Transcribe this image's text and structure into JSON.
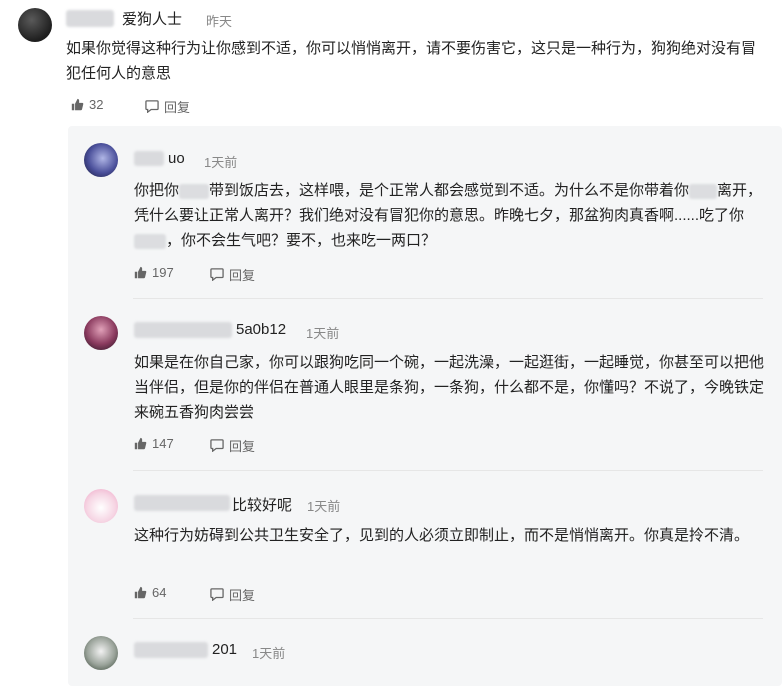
{
  "main_comment": {
    "author": "爱狗人士",
    "time": "昨天",
    "text": "如果你觉得这种行为让你感到不适，你可以悄悄离开，请不要伤害它，这只是一种行为，狗狗绝对没有冒犯任何人的意思",
    "likes": "32",
    "reply_label": "回复"
  },
  "replies": [
    {
      "author": "uo",
      "time": "1天前",
      "text_parts": [
        "你把你",
        "带到饭店去，这样喂，是个正常人都会感觉到不适。为什么不是你带着你",
        "离开，凭什么要让正常人离开？我们绝对没有冒犯你的意思。昨晚七夕，那盆狗肉真香啊......吃了你",
        "，你不会生气吧？要不，也来吃一两口？"
      ],
      "likes": "197",
      "reply_label": "回复"
    },
    {
      "author": "5a0b12",
      "time": "1天前",
      "text": "如果是在你自己家，你可以跟狗吃同一个碗，一起洗澡，一起逛街，一起睡觉，你甚至可以把他当伴侣，但是你的伴侣在普通人眼里是条狗，一条狗，什么都不是，你懂吗？不说了，今晚铁定来碗五香狗肉尝尝",
      "likes": "147",
      "reply_label": "回复"
    },
    {
      "author": "比较好呢",
      "time": "1天前",
      "text": "这种行为妨碍到公共卫生安全了，见到的人必须立即制止，而不是悄悄离开。你真是拎不清。",
      "likes": "64",
      "reply_label": "回复"
    },
    {
      "author": "201",
      "time": "1天前"
    }
  ],
  "icons": {
    "like": "thumbs-up-icon",
    "reply": "reply-bubble-icon"
  }
}
